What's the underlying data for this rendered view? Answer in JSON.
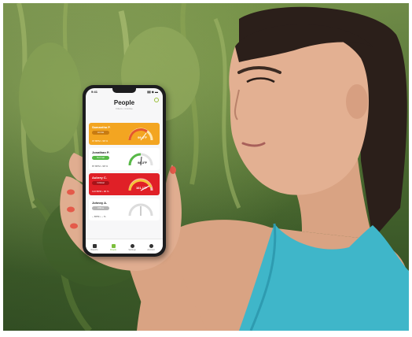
{
  "scene": {
    "description_tags": [
      "person-holding-phone",
      "outdoor-foliage-background"
    ]
  },
  "app": {
    "status_time": "9:41",
    "status_icons": "▮▮ ◆ ▬",
    "title": "People",
    "subtitle": "Filters • 4 Active",
    "cards": [
      {
        "name": "Samantha P.",
        "badge": "At risk",
        "meta": "97 BPM  •  98 %",
        "value": "99.6°F",
        "style": "orange",
        "badge_color": "#c77b12"
      },
      {
        "name": "Jonathan P.",
        "badge": "Normal",
        "meta": "87 BPM  •  98 %",
        "value": "98.3°F",
        "style": "white",
        "badge_color": "#57b947"
      },
      {
        "name": "Aubrey C.",
        "badge": "Critical",
        "meta": "113 BPM  •  90 %",
        "value": "101.1°F",
        "style": "red",
        "badge_color": "#a81319"
      },
      {
        "name": "Johnny A.",
        "badge": "Offline",
        "meta": "-- BPM  •  -- %",
        "value": "",
        "style": "white",
        "badge_color": "#b5b5b5"
      }
    ],
    "tabs": [
      {
        "label": "Reports",
        "active": false
      },
      {
        "label": "People",
        "active": true
      },
      {
        "label": "Settings",
        "active": false
      },
      {
        "label": "Account",
        "active": false
      }
    ]
  },
  "colors": {
    "accent_green": "#7cbf3c",
    "warning_orange": "#f3a521",
    "critical_red": "#e02027",
    "top_tank": "#3fb6c9"
  }
}
